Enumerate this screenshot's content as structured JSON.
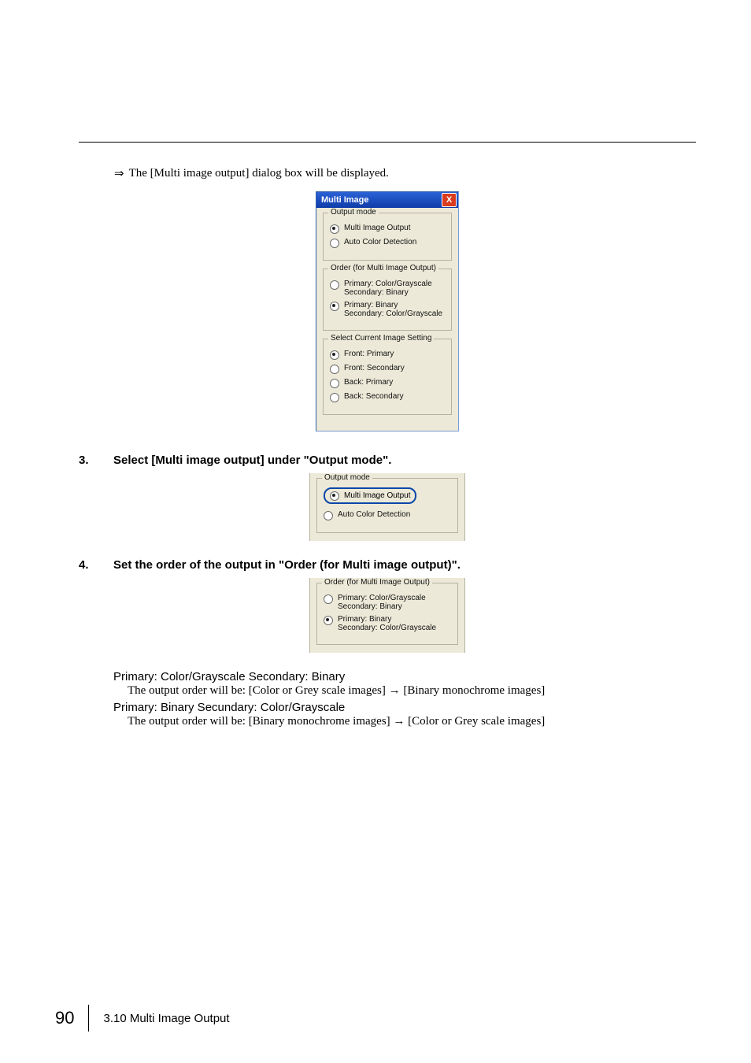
{
  "lead": {
    "arrow": "⇒",
    "text": "The  [Multi image output] dialog box will be displayed."
  },
  "dialog": {
    "title": "Multi Image",
    "close": "X",
    "groups": {
      "output_mode": {
        "legend": "Output mode",
        "opt1": "Multi Image Output",
        "opt2": "Auto Color Detection"
      },
      "order": {
        "legend": "Order (for Multi Image Output)",
        "opt1_l1": "Primary: Color/Grayscale",
        "opt1_l2": "Secondary: Binary",
        "opt2_l1": "Primary: Binary",
        "opt2_l2": "Secondary: Color/Grayscale"
      },
      "current": {
        "legend": "Select Current Image Setting",
        "opt1": "Front: Primary",
        "opt2": "Front: Secondary",
        "opt3": "Back: Primary",
        "opt4": "Back: Secondary"
      }
    }
  },
  "step3": {
    "num": "3.",
    "text": "Select [Multi image output] under \"Output mode\"."
  },
  "step4": {
    "num": "4.",
    "text": "Set the order of the output in \"Order (for Multi image output)\"."
  },
  "desc": {
    "h1": "Primary: Color/Grayscale    Secondary: Binary",
    "e1_a": "The output order will be: [Color or Grey scale images] ",
    "e1_arrow": "→",
    "e1_b": " [Binary monochrome images]",
    "h2": "Primary: Binary    Secundary: Color/Grayscale",
    "e2_a": "The output order will be: [Binary monochrome images] ",
    "e2_arrow": "→",
    "e2_b": " [Color or Grey scale images]"
  },
  "footer": {
    "page": "90",
    "section": "3.10 Multi Image Output"
  }
}
